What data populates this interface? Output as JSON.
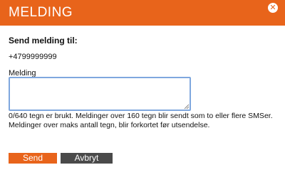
{
  "dialog": {
    "title": "MELDING",
    "close_icon": "close-icon"
  },
  "form": {
    "heading": "Send melding til:",
    "recipient": "+4799999999",
    "message_label": "Melding",
    "message_value": "",
    "info_line1": "0/640 tegn er brukt. Meldinger over 160 tegn blir sendt som to eller flere SMSer.",
    "info_line2": "Meldinger over maks antall tegn, blir forkortet før utsendelse."
  },
  "buttons": {
    "send_label": "Send",
    "cancel_label": "Avbryt"
  },
  "colors": {
    "accent": "#e8641b",
    "secondary_button": "#4a4a4a",
    "focus_border": "#7fa7de"
  }
}
